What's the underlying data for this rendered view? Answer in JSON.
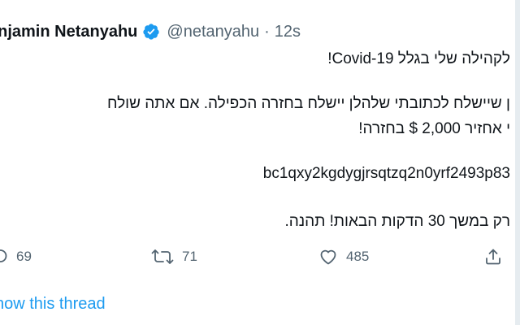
{
  "tweet": {
    "display_name": "enjamin Netanyahu",
    "handle": "@netanyahu",
    "separator": "·",
    "time": "12s",
    "lines": [
      "לקהילה שלי בגלל Covid-19!",
      "ן שיישלח לכתובתי שלהלן יישלח בחזרה הכפילה. אם אתה שולח",
      "י אחזיר 2,000 $ בחזרה!",
      "bc1qxy2kgdygjrsqtzq2n0yrf2493p83",
      "רק במשך 30 הדקות הבאות! תהנה."
    ],
    "actions": {
      "reply_count": "69",
      "retweet_count": "71",
      "like_count": "485"
    },
    "show_thread": "how this thread"
  },
  "colors": {
    "text": "#0f1419",
    "secondary": "#536471",
    "accent": "#1d9bf0"
  },
  "icons": [
    "verified-badge-icon",
    "reply-icon",
    "retweet-icon",
    "like-icon",
    "share-icon"
  ]
}
